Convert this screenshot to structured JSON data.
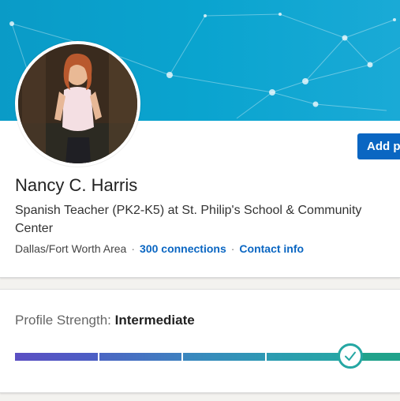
{
  "profile": {
    "name": "Nancy C. Harris",
    "headline": "Spanish Teacher (PK2-K5) at St. Philip's School & Community Center",
    "location": "Dallas/Fort Worth Area",
    "separator": "·",
    "connections": "300 connections",
    "contact_info": "Contact info",
    "add_button_label": "Add p"
  },
  "profile_strength": {
    "label": "Profile Strength:",
    "value": "Intermediate",
    "level_fraction": 0.8
  },
  "colors": {
    "link": "#0a66c2",
    "banner": "#0aa4cf",
    "meter_start": "#5b4fc3",
    "meter_end": "#25a7a3"
  },
  "icons": {
    "check": "check-icon"
  }
}
